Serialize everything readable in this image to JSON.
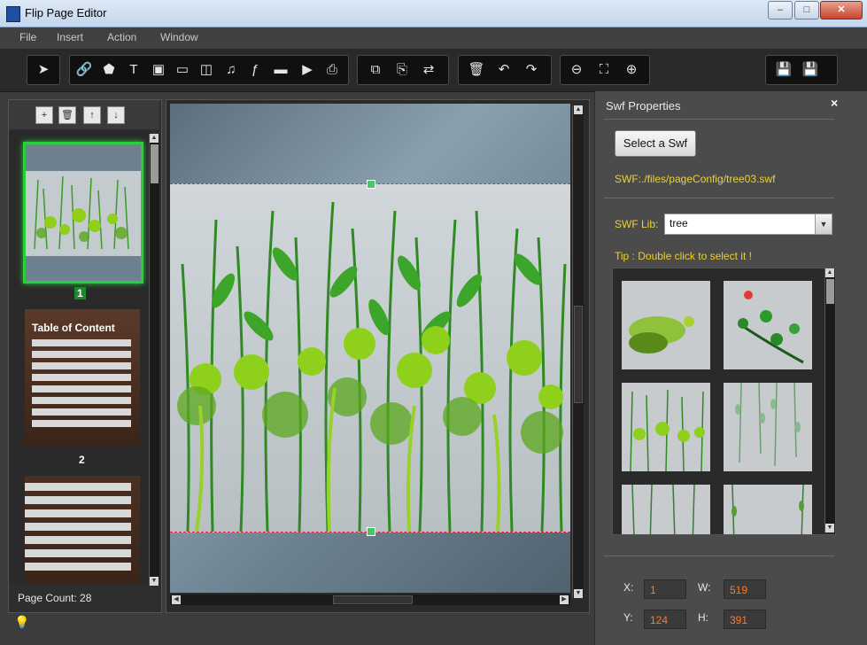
{
  "window": {
    "title": "Flip Page Editor",
    "min_label": "‒",
    "max_label": "□",
    "close_label": "✕"
  },
  "menu": [
    "File",
    "Insert",
    "Action",
    "Window"
  ],
  "toolbar": {
    "groups": [
      [
        {
          "icon": "pointer-icon",
          "glyph": "➤"
        }
      ],
      [
        {
          "icon": "link-icon",
          "glyph": "🔗"
        },
        {
          "icon": "shape-icon",
          "glyph": "⬟"
        },
        {
          "icon": "text-icon",
          "glyph": "T"
        },
        {
          "icon": "video-icon",
          "glyph": "▣"
        },
        {
          "icon": "image-icon",
          "glyph": "▭"
        },
        {
          "icon": "slideshow-icon",
          "glyph": "◫"
        },
        {
          "icon": "music-icon",
          "glyph": "♫"
        },
        {
          "icon": "flash-icon",
          "glyph": "ƒ"
        },
        {
          "icon": "button-icon",
          "glyph": "▬"
        },
        {
          "icon": "youtube-icon",
          "glyph": "▶"
        },
        {
          "icon": "print-icon",
          "glyph": "⎙"
        }
      ],
      [
        {
          "icon": "copy-icon",
          "glyph": "⧉"
        },
        {
          "icon": "paste-icon",
          "glyph": "⎘"
        },
        {
          "icon": "swap-icon",
          "glyph": "⇄"
        }
      ],
      [
        {
          "icon": "delete-icon",
          "glyph": "🗑"
        },
        {
          "icon": "undo-icon",
          "glyph": "↶"
        },
        {
          "icon": "redo-icon",
          "glyph": "↷"
        }
      ],
      [
        {
          "icon": "zoom-out-icon",
          "glyph": "⊖"
        },
        {
          "icon": "fit-icon",
          "glyph": "⛶"
        },
        {
          "icon": "zoom-in-icon",
          "glyph": "⊕"
        }
      ],
      [
        {
          "icon": "save-icon",
          "glyph": "💾"
        },
        {
          "icon": "save-as-icon",
          "glyph": "💾"
        }
      ]
    ]
  },
  "pages": {
    "tools": [
      {
        "icon": "add-page-icon",
        "glyph": "+"
      },
      {
        "icon": "delete-page-icon",
        "glyph": "🗑"
      },
      {
        "icon": "move-up-icon",
        "glyph": "↑"
      },
      {
        "icon": "move-down-icon",
        "glyph": "↓"
      }
    ],
    "thumb1_number": "1",
    "thumb2_title": "Table of Content",
    "thumb2_number": "2",
    "page_count": "Page Count: 28"
  },
  "properties": {
    "title": "Swf Properties",
    "close": "×",
    "select_button": "Select a Swf",
    "swf_path": "SWF:./files/pageConfig/tree03.swf",
    "lib_label": "SWF Lib:",
    "lib_value": "tree",
    "tip": "Tip : Double click to select it !",
    "x_label": "X:",
    "x": "1",
    "w_label": "W:",
    "w": "519",
    "y_label": "Y:",
    "y": "124",
    "h_label": "H:",
    "h": "391"
  },
  "colors": {
    "accent_green": "#29d03a",
    "label_yellow": "#e8d23c",
    "value_orange": "#ff7a2a",
    "guide_red": "#e22244"
  }
}
